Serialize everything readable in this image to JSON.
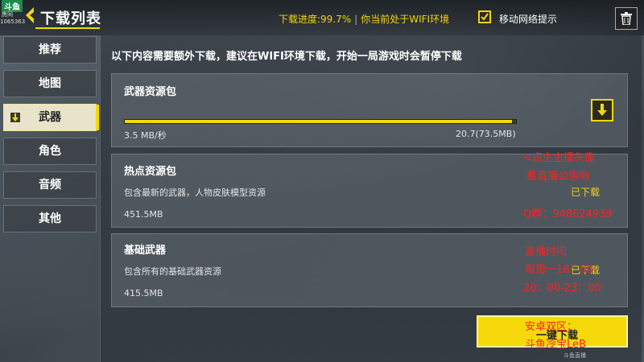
{
  "header": {
    "logo_top": "斗鱼",
    "logo_sub": "房间",
    "room_id": "1065363",
    "title": "下载列表",
    "progress_text": "下载进度:99.7%",
    "wifi_text": "你当前处于WIFI环境",
    "mobile_prompt_label": "移动网络提示",
    "mobile_prompt_checked": true
  },
  "sidebar": {
    "items": [
      {
        "label": "推荐"
      },
      {
        "label": "地图"
      },
      {
        "label": "武器",
        "active": true
      },
      {
        "label": "角色"
      },
      {
        "label": "音频"
      },
      {
        "label": "其他"
      }
    ]
  },
  "notice": "以下内容需要额外下载，建议在WIFI环境下载，开始一局游戏时会暂停下载",
  "packages": [
    {
      "title": "武器资源包",
      "speed": "3.5 MB/秒",
      "downloaded": "20.7(73.5MB)",
      "progress": 0.99
    },
    {
      "title": "热点资源包",
      "description": "包含最新的武器，人物皮肤模型资源",
      "size": "451.5MB",
      "status": "已下载"
    },
    {
      "title": "基础武器",
      "description": "包含所有的基础武器资源",
      "size": "415.5MB",
      "status": "已下载"
    }
  ],
  "one_key_download_label": "一键下载",
  "stream_overlay": {
    "line1": "<点主主播头像",
    "line2": "看直播公告哟",
    "line3": "Q群：948624939",
    "line4": "直播时间",
    "line5": "每周一16：00",
    "line6": "20：00-23：00",
    "line7": "安卓双区：",
    "line8": "斗鱼冷宝LeB"
  },
  "watermark": "斗鱼直播"
}
